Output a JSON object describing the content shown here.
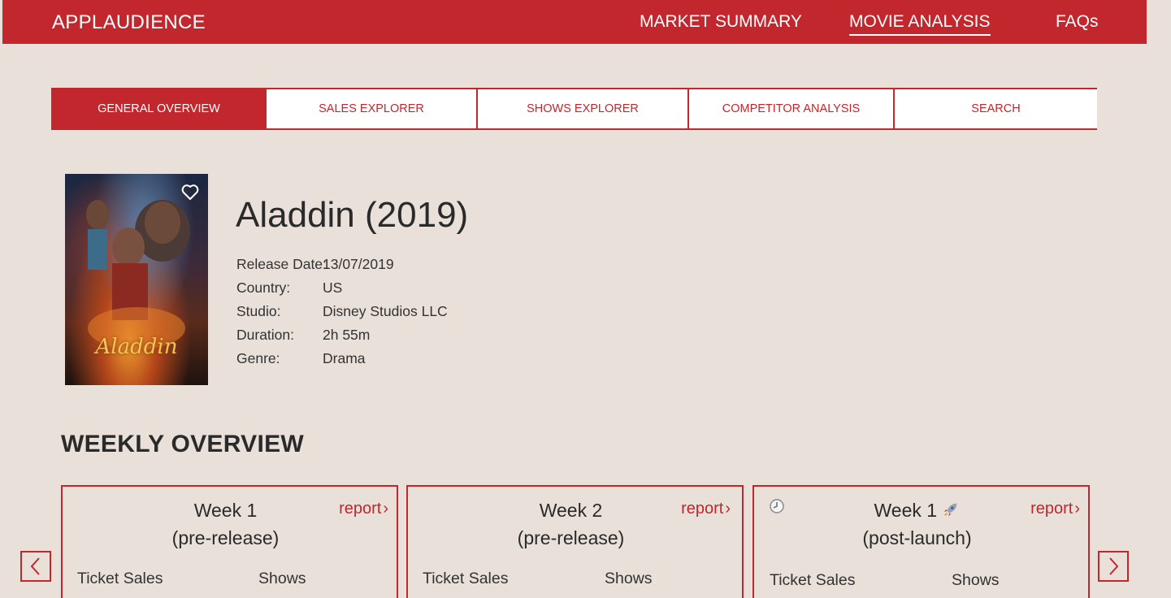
{
  "brand": "APPLAUDIENCE",
  "top_nav": [
    {
      "label": "MARKET SUMMARY",
      "active": false
    },
    {
      "label": "MOVIE ANALYSIS",
      "active": true
    },
    {
      "label": "FAQs",
      "active": false
    }
  ],
  "tabs": [
    {
      "label": "GENERAL OVERVIEW",
      "active": true
    },
    {
      "label": "SALES EXPLORER",
      "active": false
    },
    {
      "label": "SHOWS EXPLORER",
      "active": false
    },
    {
      "label": "COMPETITOR ANALYSIS",
      "active": false
    },
    {
      "label": "SEARCH",
      "active": false
    }
  ],
  "movie": {
    "title": "Aladdin (2019)",
    "poster_title": "Aladdin",
    "details": [
      {
        "label": "Release Date:",
        "value": "13/07/2019"
      },
      {
        "label": "Country:",
        "value": "US"
      },
      {
        "label": "Studio:",
        "value": "Disney Studios LLC"
      },
      {
        "label": "Duration:",
        "value": "2h 55m"
      },
      {
        "label": "Genre:",
        "value": "Drama"
      }
    ]
  },
  "weekly": {
    "heading": "WEEKLY OVERVIEW",
    "cards": [
      {
        "title_line1": "Week 1",
        "title_line2": "(pre-release)",
        "report": "report",
        "col1": "Ticket Sales",
        "col2": "Shows",
        "clock": false,
        "rocket": false
      },
      {
        "title_line1": "Week 2",
        "title_line2": "(pre-release)",
        "report": "report",
        "col1": "Ticket Sales",
        "col2": "Shows",
        "clock": false,
        "rocket": false
      },
      {
        "title_line1": "Week 1",
        "title_line2": "(post-launch)",
        "report": "report",
        "col1": "Ticket Sales",
        "col2": "Shows",
        "clock": true,
        "rocket": true
      }
    ]
  },
  "colors": {
    "accent": "#c1272d",
    "background": "#e8e0d9"
  }
}
